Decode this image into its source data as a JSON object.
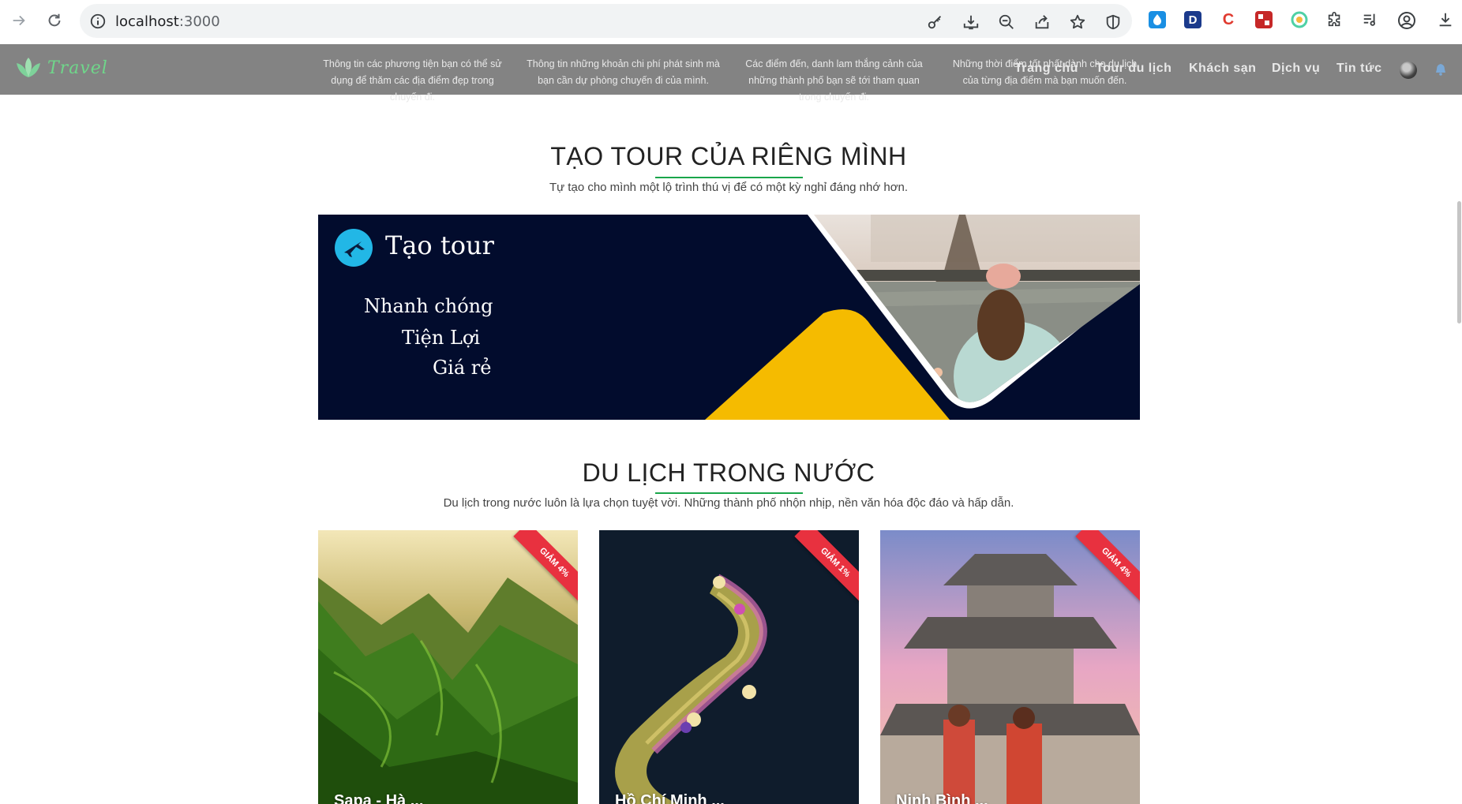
{
  "browser": {
    "url_host": "localhost",
    "url_port": ":3000"
  },
  "header": {
    "logo_text": "Travel",
    "features": [
      "Thông tin các phương tiện bạn có thể sử dụng để thăm các địa điểm đẹp trong chuyến đi.",
      "Thông tin những khoản chi phí phát sinh mà bạn cần dự phòng chuyến đi của mình.",
      "Các điểm đến, danh lam thắng cảnh của những thành phố bạn sẽ tới tham quan trong chuyến đi.",
      "Những thời điểm tốt nhất dành cho du lịch của từng địa điểm mà bạn muốn đến."
    ],
    "menu": [
      "Trang chủ",
      "Tour du lịch",
      "Khách sạn",
      "Dịch vụ",
      "Tin tức"
    ]
  },
  "custom_tour": {
    "title": "TẠO TOUR CỦA RIÊNG MÌNH",
    "subtitle": "Tự tạo cho mình một lộ trình thú vị để có một kỳ nghỉ đáng nhớ hơn.",
    "banner": {
      "title": "Tạo tour",
      "lines": [
        "Nhanh chóng",
        "Tiện Lợi",
        "Giá rẻ"
      ]
    }
  },
  "domestic": {
    "title": "DU LỊCH TRONG NƯỚC",
    "subtitle": "Du lịch trong nước luôn là lựa chọn tuyệt vời. Những thành phố nhộn nhịp, nền văn hóa độc đáo và hấp dẫn.",
    "cards": [
      {
        "discount": "GIẢM 4%",
        "name": "Sapa - Hà ..."
      },
      {
        "discount": "GIẢM 1%",
        "name": "Hồ Chí Minh ..."
      },
      {
        "discount": "GIẢM 4%",
        "name": "Ninh Bình ..."
      }
    ]
  },
  "colors": {
    "accent_green": "#1aa64a",
    "banner_navy": "#020c2d",
    "banner_yellow": "#f5bb00",
    "ribbon_red": "#e8313f"
  }
}
